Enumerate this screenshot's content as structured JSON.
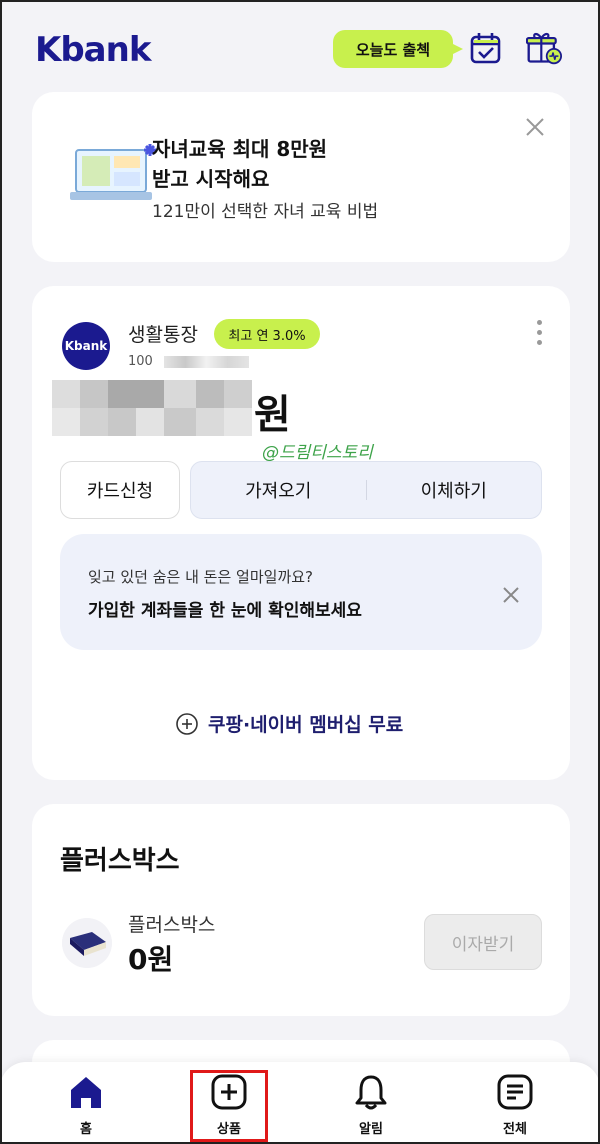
{
  "header": {
    "logo": "Kbank",
    "attendance_label": "오늘도 출첵",
    "icons": [
      "calendar-check-icon",
      "gift-box-icon"
    ]
  },
  "promo": {
    "title": "자녀교육 최대 8만원\n받고 시작해요",
    "title_line1": "자녀교육 최대 8만원",
    "title_line2": "받고 시작해요",
    "subtitle": "121만이 선택한 자녀 교육 비법"
  },
  "account": {
    "logo_text": "Kbank",
    "name": "생활통장",
    "rate_badge": "최고 연 3.0%",
    "number_prefix": "100",
    "balance_suffix": "원",
    "watermark": "@드림티스토리",
    "buttons": {
      "card": "카드신청",
      "fetch": "가져오기",
      "transfer": "이체하기"
    },
    "notice": {
      "question": "잊고 있던 숨은 내 돈은 얼마일까요?",
      "text": "가입한 계좌들을 한 눈에 확인해보세요"
    },
    "coupon": "쿠팡·네이버 멤버십 무료"
  },
  "plusbox": {
    "title": "플러스박스",
    "item_name": "플러스박스",
    "amount": "0원",
    "interest_button": "이자받기"
  },
  "bottom_nav": {
    "home": "홈",
    "products": "상품",
    "alerts": "알림",
    "all": "전체"
  },
  "colors": {
    "brand": "#1b1a8f",
    "accent": "#c8f04d",
    "highlight": "#e01919"
  }
}
